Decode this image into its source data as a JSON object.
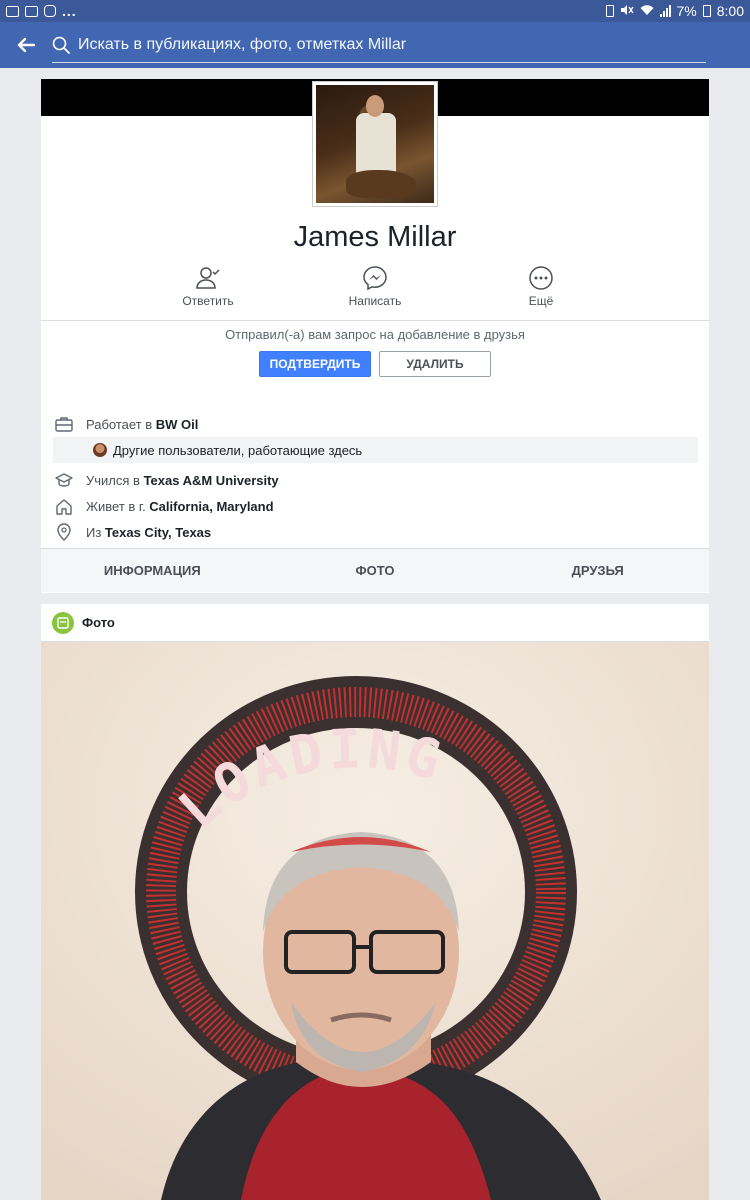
{
  "status_bar": {
    "battery": "7%",
    "time": "8:00"
  },
  "search": {
    "placeholder": "Искать в публикациях, фото, отметках Millar"
  },
  "profile": {
    "name": "James Millar",
    "actions": [
      {
        "label": "Ответить",
        "icon": "person-check-icon"
      },
      {
        "label": "Написать",
        "icon": "messenger-icon"
      },
      {
        "label": "Ещё",
        "icon": "more-icon"
      }
    ],
    "friend_request": {
      "text": "Отправил(-а) вам запрос на добавление в друзья",
      "confirm_label": "ПОДТВЕРДИТЬ",
      "delete_label": "УДАЛИТЬ"
    },
    "info": {
      "work_prefix": "Работает в ",
      "work": "BW Oil",
      "coworkers": "Другие пользователи, работающие здесь",
      "edu_prefix": "Учился в ",
      "edu": "Texas A&M University",
      "lives_prefix": "Живет в г. ",
      "lives": "California, Maryland",
      "from_prefix": "Из ",
      "from": "Texas City, Texas"
    },
    "tabs": [
      "ИНФОРМАЦИЯ",
      "ФОТО",
      "ДРУЗЬЯ"
    ]
  },
  "photos": {
    "title": "Фото",
    "ring_text": "LOADING"
  },
  "colors": {
    "brand": "#4267b2",
    "status_bar": "#3b5998",
    "confirm": "#4080ff",
    "photos_icon": "#8ac33e"
  }
}
